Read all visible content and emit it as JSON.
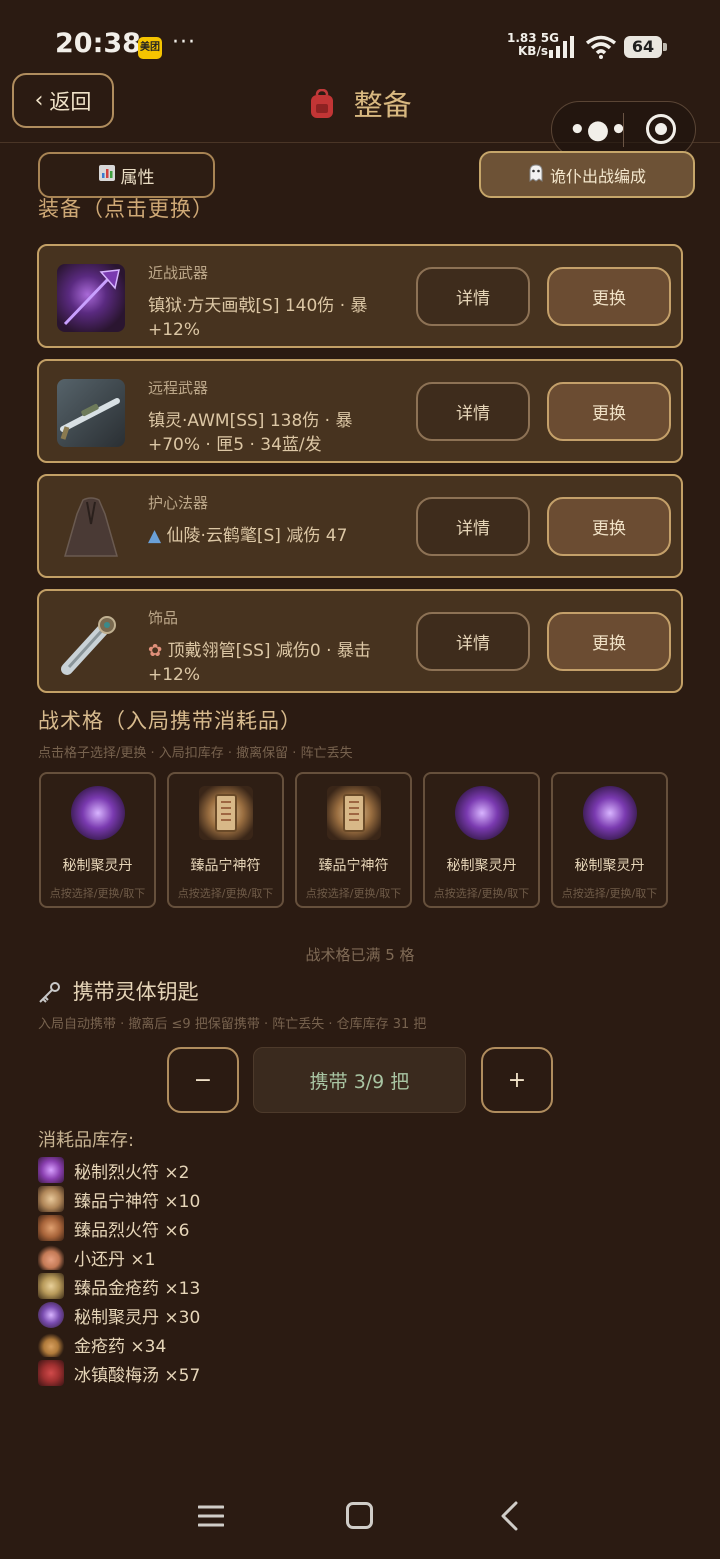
{
  "status_bar": {
    "time": "20:38",
    "app_badge": "美团",
    "more": "···",
    "net_speed": "1.83",
    "net_unit": "KB/s",
    "net_type": "5G",
    "battery": "64"
  },
  "header": {
    "back_label": "返回",
    "title": "整备",
    "title_icon": "backpack-icon"
  },
  "toolbar": {
    "attributes_label": "属性",
    "formation_label": "诡仆出战编成"
  },
  "equipment": {
    "section_title": "装备（点击更换）",
    "items": [
      {
        "category": "近战武器",
        "desc": "镇狱·方天画戟[S]  140伤 · 暴+12%",
        "detail": "详情",
        "swap": "更换",
        "icon": "halberd-icon",
        "color": "#6b3a9a"
      },
      {
        "category": "远程武器",
        "desc": "镇灵·AWM[SS]  138伤 · 暴+70% · 匣5 · 34蓝/发",
        "detail": "详情",
        "swap": "更换",
        "icon": "sniper-rifle-icon",
        "color": "#8f9aa0"
      },
      {
        "category": "护心法器",
        "desc": "仙陵·云鹤氅[S]  减伤 47",
        "detail": "详情",
        "swap": "更换",
        "icon": "cloak-icon",
        "color": "#5a4a42"
      },
      {
        "category": "饰品",
        "desc": "顶戴翎管[SS]  减伤0 · 暴击+12%",
        "detail": "详情",
        "swap": "更换",
        "icon": "feather-tube-icon",
        "color": "#9ba4a8"
      }
    ]
  },
  "tactical": {
    "title": "战术格（入局携带消耗品）",
    "hint": "点击格子选择/更换 · 入局扣库存 · 撤离保留 · 阵亡丢失",
    "slot_hint": "点按选择/更换/取下",
    "slots": [
      {
        "name": "秘制聚灵丹",
        "icon": "spirit-pill-icon"
      },
      {
        "name": "臻品宁神符",
        "icon": "talisman-icon"
      },
      {
        "name": "臻品宁神符",
        "icon": "talisman-icon"
      },
      {
        "name": "秘制聚灵丹",
        "icon": "spirit-pill-icon"
      },
      {
        "name": "秘制聚灵丹",
        "icon": "spirit-pill-icon"
      }
    ],
    "full_notice": "战术格已满 5 格"
  },
  "key": {
    "title": "携带灵体钥匙",
    "hint": "入局自动携带 · 撤离后 ≤9 把保留携带 · 阵亡丢失 · 仓库库存 31 把",
    "minus": "−",
    "plus": "+",
    "carry_label": "携带 3/9 把"
  },
  "inventory": {
    "title": "消耗品库存:",
    "items": [
      {
        "label": "秘制烈火符 ×2",
        "icon": "fire-talisman-icon",
        "color": "#8a3fb0"
      },
      {
        "label": "臻品宁神符 ×10",
        "icon": "talisman-icon",
        "color": "#b08658"
      },
      {
        "label": "臻品烈火符 ×6",
        "icon": "fire-talisman-icon",
        "color": "#a8643a"
      },
      {
        "label": "小还丹 ×1",
        "icon": "pill-bottle-icon",
        "color": "#c47a56"
      },
      {
        "label": "臻品金疮药 ×13",
        "icon": "medicine-jar-icon",
        "color": "#b89a5a"
      },
      {
        "label": "秘制聚灵丹 ×30",
        "icon": "spirit-pill-icon",
        "color": "#7a4cb0"
      },
      {
        "label": "金疮药 ×34",
        "icon": "medicine-bottle-icon",
        "color": "#b07a3a"
      },
      {
        "label": "冰镇酸梅汤 ×57",
        "icon": "plum-drink-icon",
        "color": "#a03030"
      }
    ]
  }
}
